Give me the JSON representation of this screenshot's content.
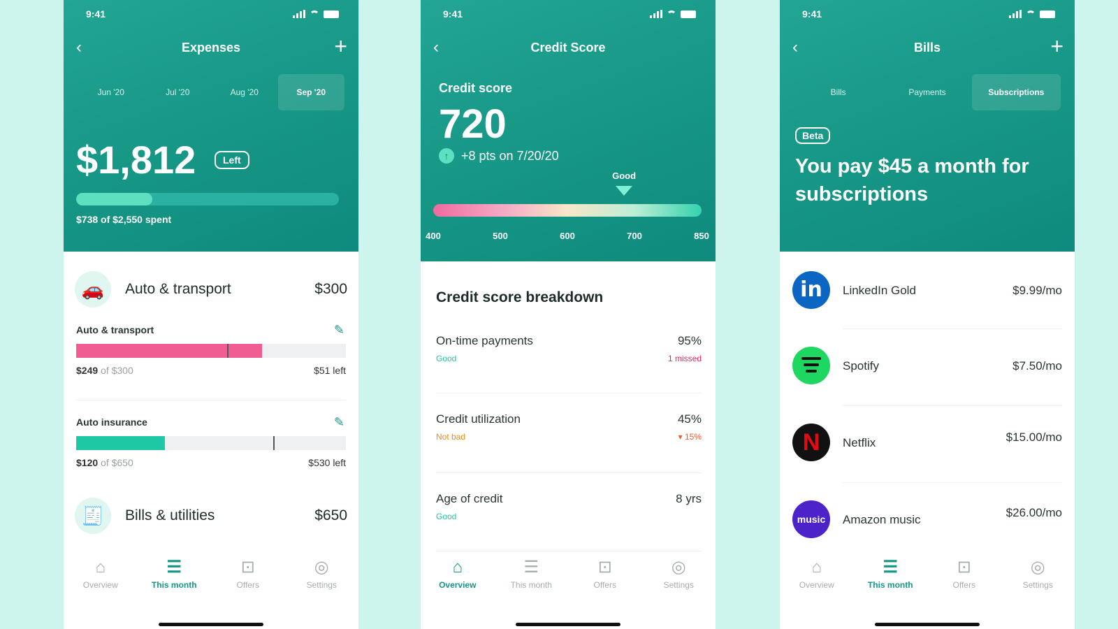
{
  "status": {
    "time": "9:41"
  },
  "tabbar": [
    "Overview",
    "This month",
    "Offers",
    "Settings"
  ],
  "expenses": {
    "title": "Expenses",
    "tabs": [
      "Jun '20",
      "Jul '20",
      "Aug '20",
      "Sep '20"
    ],
    "active_tab": "Sep '20",
    "amount": "$1,812",
    "left_badge": "Left",
    "spent_progress": 0.29,
    "spent_text": "$738 of $2,550 spent",
    "categories": [
      {
        "name": "Auto & transport",
        "amount": "$300",
        "icon": "car-icon"
      },
      {
        "name": "Bills & utilities",
        "amount": "$650",
        "icon": "bill-icon"
      }
    ],
    "subcategories": [
      {
        "label": "Auto & transport",
        "spent": "$249",
        "of": "of $300",
        "left": "$51 left",
        "progress": 0.69,
        "marker": 0.56,
        "color": "#f05d92"
      },
      {
        "label": "Auto insurance",
        "spent": "$120",
        "of": "of $650",
        "left": "$530 left",
        "progress": 0.33,
        "marker": 0.73,
        "color": "#1fc8a5"
      }
    ],
    "active_tab_index": 1
  },
  "credit": {
    "title": "Credit Score",
    "label": "Credit score",
    "value": "720",
    "change": "+8 pts on 7/20/20",
    "grade": "Good",
    "score_min": 400,
    "score_max": 850,
    "score": 720,
    "ticks": [
      "400",
      "500",
      "600",
      "700",
      "850"
    ],
    "breakdown_title": "Credit score breakdown",
    "breakdown": [
      {
        "name": "On-time payments",
        "value": "95%",
        "grade": "Good",
        "grade_color": "#1fc8a5",
        "note": "1 missed",
        "note_color": "#e8245e"
      },
      {
        "name": "Credit utilization",
        "value": "45%",
        "grade": "Not bad",
        "grade_color": "#f08a1a",
        "note": "▾ 15%",
        "note_color": "#f05d2a"
      },
      {
        "name": "Age of credit",
        "value": "8 yrs",
        "grade": "Good",
        "grade_color": "#1fc8a5",
        "note": "",
        "note_color": "#333"
      }
    ],
    "active_tab_index": 0
  },
  "bills": {
    "title": "Bills",
    "tabs": [
      "Bills",
      "Payments",
      "Subscriptions"
    ],
    "active_tab": "Subscriptions",
    "beta": "Beta",
    "headline": "You pay $45 a month for subscriptions",
    "subscriptions": [
      {
        "name": "LinkedIn Gold",
        "price": "$9.99/mo",
        "logo_text": "in"
      },
      {
        "name": "Spotify",
        "price": "$7.50/mo",
        "logo_text": ""
      },
      {
        "name": "Netflix",
        "price": "$15.00/mo",
        "logo_text": "N"
      },
      {
        "name": "Amazon music",
        "price": "$26.00/mo",
        "logo_text": "music"
      }
    ],
    "active_tab_index": 1
  }
}
